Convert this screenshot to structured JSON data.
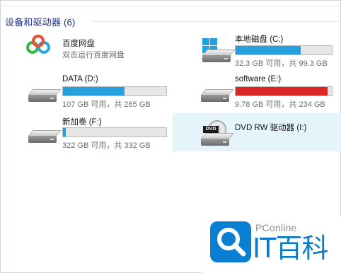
{
  "section": {
    "title": "设备和驱动器 (6)"
  },
  "tiles": [
    {
      "name": "百度网盘",
      "sub": "双击运行百度网盘",
      "icon": "baidu-netdisk-icon"
    },
    {
      "name": "本地磁盘 (C:)",
      "sub": "32.3 GB 可用，共 99.3 GB",
      "icon": "windows-drive-icon",
      "used_fraction": 0.675,
      "bar_color": "#26a0da"
    },
    {
      "name": "DATA (D:)",
      "sub": "107 GB 可用，共 265 GB",
      "icon": "hard-drive-icon",
      "used_fraction": 0.596,
      "bar_color": "#26a0da"
    },
    {
      "name": "software (E:)",
      "sub": "9.78 GB 可用，共 234 GB",
      "icon": "hard-drive-icon",
      "used_fraction": 0.958,
      "bar_color": "#da2626"
    },
    {
      "name": "新加卷 (F:)",
      "sub": "322 GB 可用，共 332 GB",
      "icon": "hard-drive-icon",
      "used_fraction": 0.03,
      "bar_color": "#26a0da"
    },
    {
      "name": "DVD RW 驱动器 (I:)",
      "icon": "dvd-drive-icon",
      "icon_text": "DVD",
      "selected": true
    }
  ],
  "watermark": {
    "brand": "PConline",
    "mark": "IT百科"
  },
  "colors": {
    "accent": "#26a0da",
    "warning": "#da2626",
    "selected_bg": "#e5f3fb",
    "title": "#1e3287"
  }
}
